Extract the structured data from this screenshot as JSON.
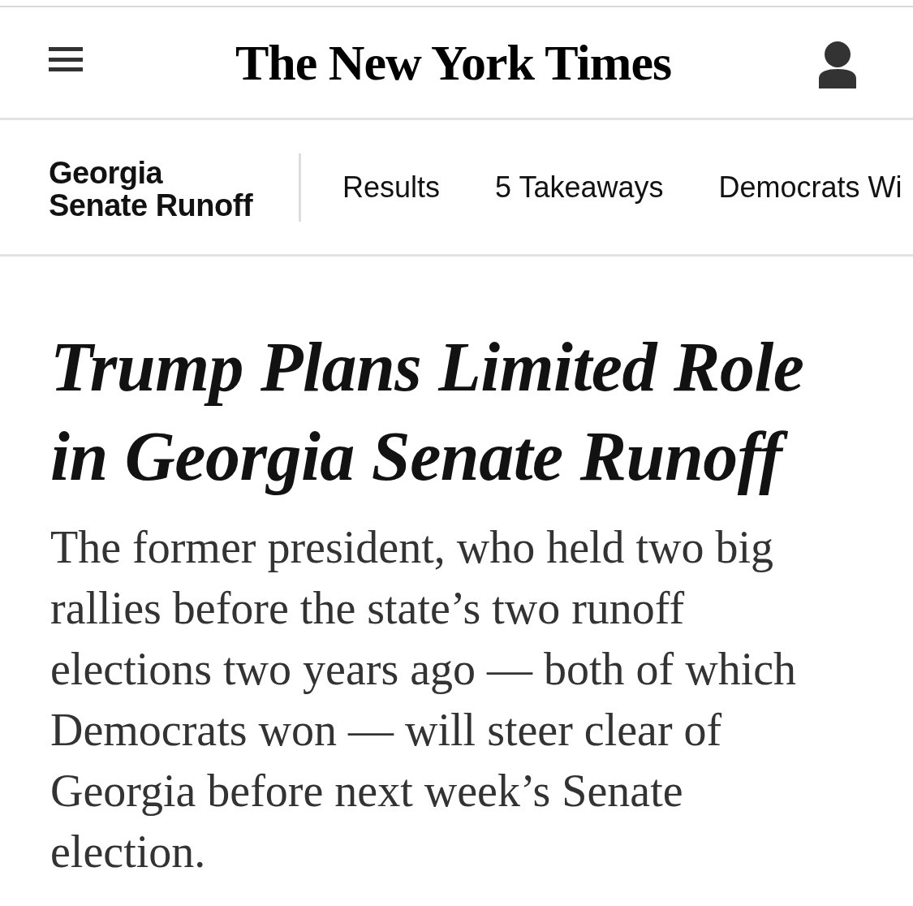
{
  "top_bar": {
    "logo": "The New York Times"
  },
  "section_nav": {
    "title": "Georgia Senate Runoff",
    "links": [
      {
        "label": "Results"
      },
      {
        "label": "5 Takeaways"
      },
      {
        "label": "Democrats Wi"
      }
    ]
  },
  "article": {
    "headline": "Trump Plans Limited Role in Georgia Senate Runoff",
    "summary": "The former president, who held two big rallies before the state’s two runoff elections two years ago — both of which Democrats won — will steer clear of Georgia before next week’s Senate election."
  }
}
